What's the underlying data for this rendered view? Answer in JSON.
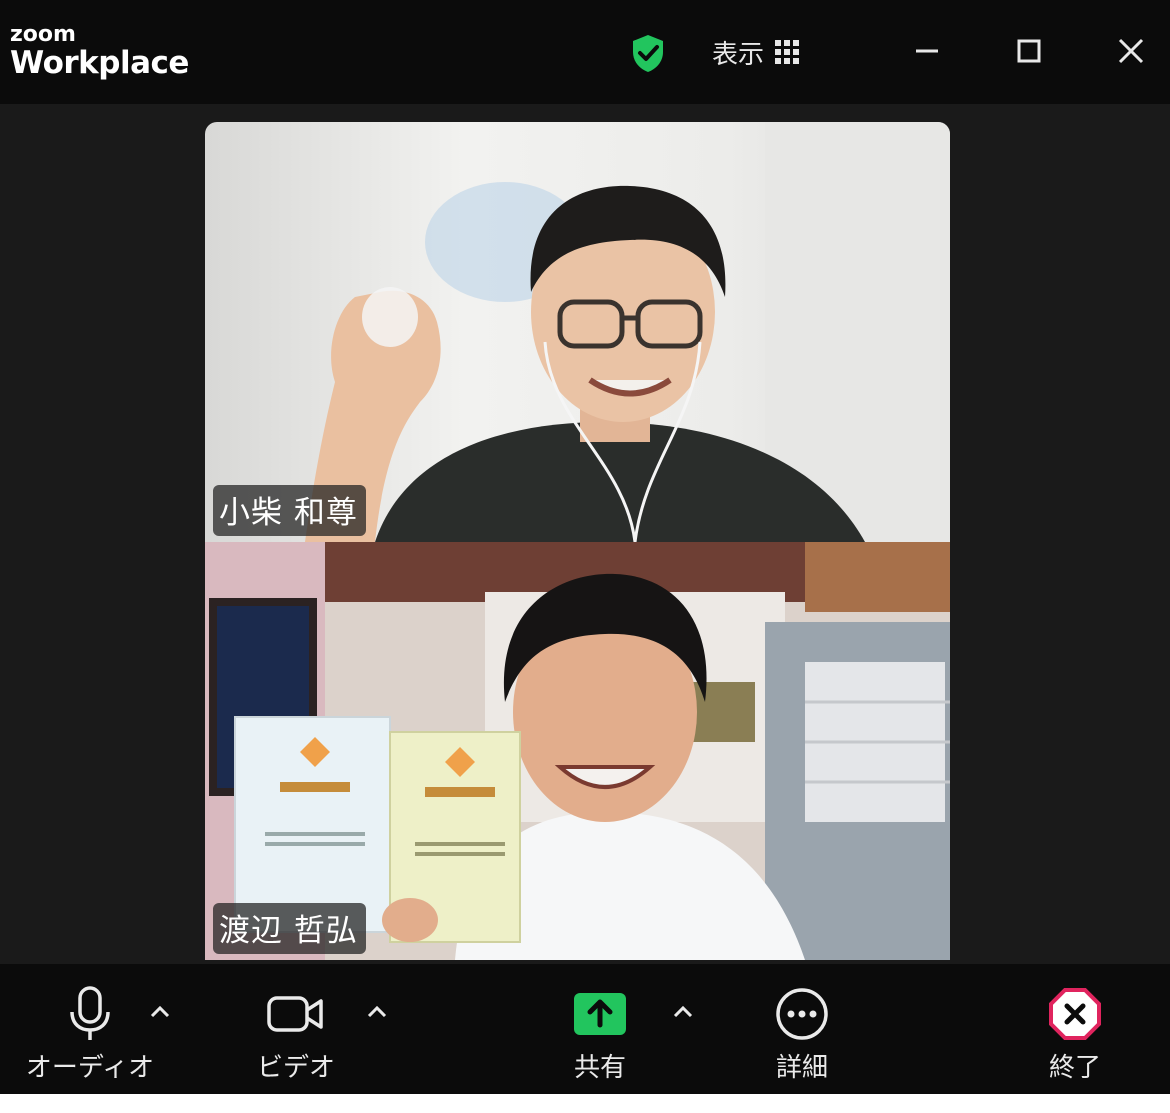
{
  "app": {
    "logo_top": "zoom",
    "logo_bottom": "Workplace",
    "view_label": "表示"
  },
  "participants": [
    {
      "name": "小柴 和尊"
    },
    {
      "name": "渡辺 哲弘"
    }
  ],
  "toolbar": {
    "audio_label": "オーディオ",
    "video_label": "ビデオ",
    "share_label": "共有",
    "more_label": "詳細",
    "end_label": "終了"
  },
  "colors": {
    "accent_green": "#22c55e",
    "end_red": "#e0245e",
    "background": "#1a1a1a"
  }
}
